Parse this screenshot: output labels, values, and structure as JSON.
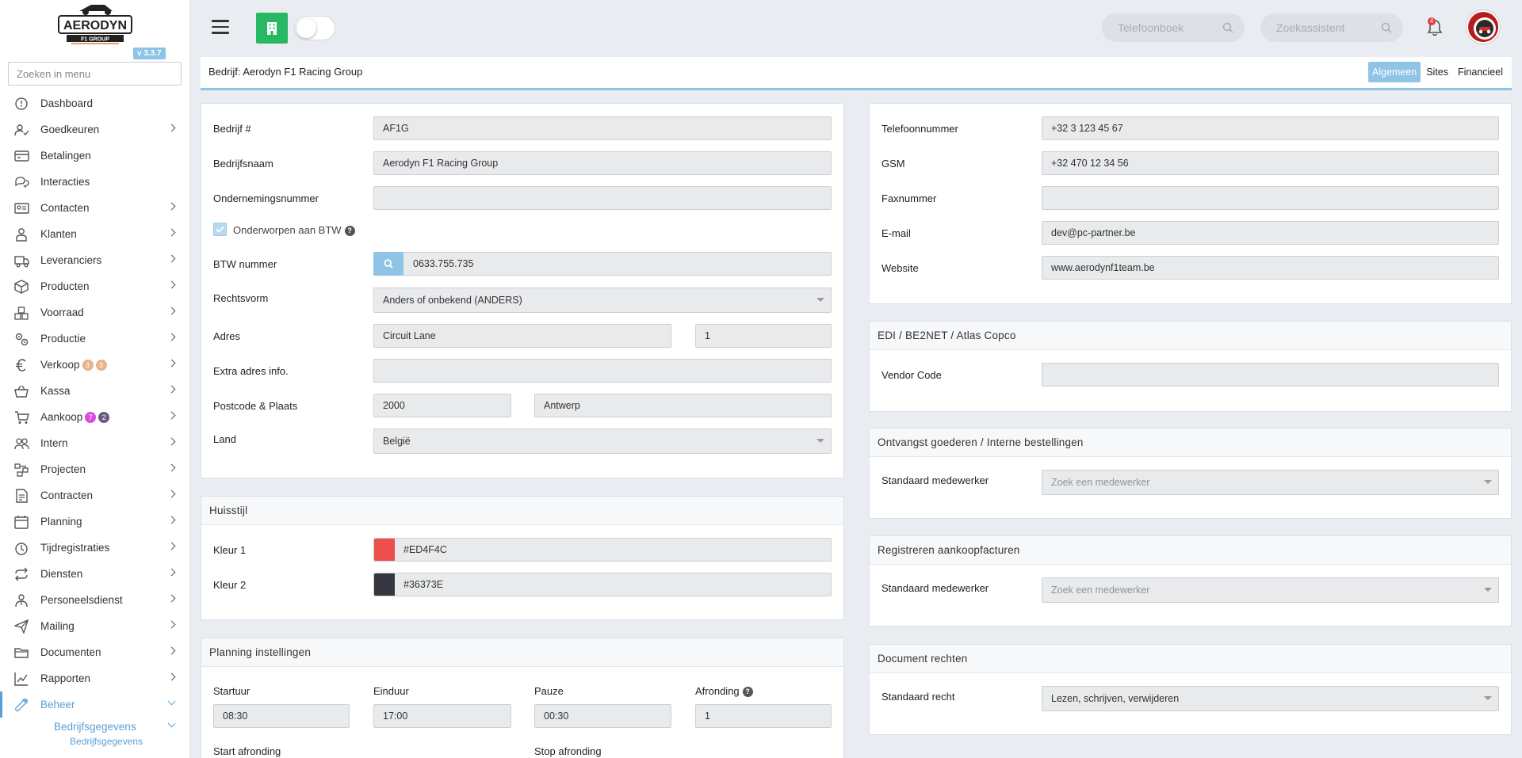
{
  "app": {
    "logo_text": "AERODYN",
    "logo_sub": "F1 GROUP",
    "version": "v 3.3.7"
  },
  "sidebar": {
    "search_placeholder": "Zoeken in menu",
    "items": [
      {
        "label": "Dashboard",
        "icon": "dashboard-icon",
        "chevron": false
      },
      {
        "label": "Goedkeuren",
        "icon": "user-check-icon",
        "chevron": true
      },
      {
        "label": "Betalingen",
        "icon": "credit-card-icon",
        "chevron": false
      },
      {
        "label": "Interacties",
        "icon": "chat-icon",
        "chevron": false
      },
      {
        "label": "Contacten",
        "icon": "contact-card-icon",
        "chevron": true
      },
      {
        "label": "Klanten",
        "icon": "customer-icon",
        "chevron": true
      },
      {
        "label": "Leveranciers",
        "icon": "truck-icon",
        "chevron": true
      },
      {
        "label": "Producten",
        "icon": "box-icon",
        "chevron": true
      },
      {
        "label": "Voorraad",
        "icon": "boxes-icon",
        "chevron": true
      },
      {
        "label": "Productie",
        "icon": "gears-icon",
        "chevron": true
      },
      {
        "label": "Verkoop",
        "icon": "euro-icon",
        "chevron": true,
        "badges": [
          {
            "text": "3",
            "color": "#e6b38a"
          },
          {
            "text": "3",
            "color": "#e6b38a"
          }
        ]
      },
      {
        "label": "Kassa",
        "icon": "basket-icon",
        "chevron": true
      },
      {
        "label": "Aankoop",
        "icon": "cart-icon",
        "chevron": true,
        "badges": [
          {
            "text": "7",
            "color": "#d94bd9"
          },
          {
            "text": "2",
            "color": "#6b5b7b"
          }
        ]
      },
      {
        "label": "Intern",
        "icon": "users-icon",
        "chevron": true
      },
      {
        "label": "Projecten",
        "icon": "project-icon",
        "chevron": true
      },
      {
        "label": "Contracten",
        "icon": "contract-icon",
        "chevron": true
      },
      {
        "label": "Planning",
        "icon": "calendar-icon",
        "chevron": true
      },
      {
        "label": "Tijdregistraties",
        "icon": "timer-icon",
        "chevron": true
      },
      {
        "label": "Diensten",
        "icon": "repeat-icon",
        "chevron": true
      },
      {
        "label": "Personeelsdienst",
        "icon": "personnel-icon",
        "chevron": true
      },
      {
        "label": "Mailing",
        "icon": "send-icon",
        "chevron": true
      },
      {
        "label": "Documenten",
        "icon": "folder-icon",
        "chevron": true
      },
      {
        "label": "Rapporten",
        "icon": "chart-line-icon",
        "chevron": true
      },
      {
        "label": "Beheer",
        "icon": "wrench-icon",
        "chevron": true,
        "active": true
      }
    ],
    "sub_item": "Bedrijfsgegevens",
    "sub_sub_item": "Bedrijfsgegevens"
  },
  "topbar": {
    "phonebook_placeholder": "Telefoonboek",
    "assistant_placeholder": "Zoekassistent",
    "notification_count": "4"
  },
  "page": {
    "title": "Bedrijf: Aerodyn F1 Racing Group",
    "tabs": [
      {
        "label": "Algemeen",
        "active": true
      },
      {
        "label": "Sites",
        "active": false
      },
      {
        "label": "Financieel",
        "active": false
      }
    ]
  },
  "general": {
    "company_no_label": "Bedrijf #",
    "company_no": "AF1G",
    "name_label": "Bedrijfsnaam",
    "name": "Aerodyn F1 Racing Group",
    "enterprise_no_label": "Ondernemingsnummer",
    "enterprise_no": "",
    "vat_subject_label": "Onderworpen aan BTW",
    "vat_label": "BTW nummer",
    "vat": "0633.755.735",
    "legal_form_label": "Rechtsvorm",
    "legal_form": "Anders of onbekend (ANDERS)",
    "address_label": "Adres",
    "street": "Circuit Lane",
    "house_no": "1",
    "extra_label": "Extra adres info.",
    "extra": "",
    "postal_label": "Postcode & Plaats",
    "postal": "2000",
    "city": "Antwerp",
    "country_label": "Land",
    "country": "België"
  },
  "contact": {
    "phone_label": "Telefoonnummer",
    "phone": "+32 3 123 45 67",
    "gsm_label": "GSM",
    "gsm": "+32 470 12 34 56",
    "fax_label": "Faxnummer",
    "fax": "",
    "email_label": "E-mail",
    "email": "dev@pc-partner.be",
    "website_label": "Website",
    "website": "www.aerodynf1team.be"
  },
  "style": {
    "title": "Huisstijl",
    "color1_label": "Kleur 1",
    "color1": "#ED4F4C",
    "color2_label": "Kleur 2",
    "color2": "#36373E"
  },
  "edi": {
    "title": "EDI / BE2NET / Atlas Copco",
    "vendor_label": "Vendor Code",
    "vendor": ""
  },
  "receipt": {
    "title": "Ontvangst goederen / Interne bestellingen",
    "employee_label": "Standaard medewerker",
    "employee_placeholder": "Zoek een medewerker"
  },
  "purchase": {
    "title": "Registreren aankoopfacturen",
    "employee_label": "Standaard medewerker",
    "employee_placeholder": "Zoek een medewerker"
  },
  "docs": {
    "title": "Document rechten",
    "right_label": "Standaard recht",
    "right": "Lezen, schrijven, verwijderen"
  },
  "planning": {
    "title": "Planning instellingen",
    "start_label": "Startuur",
    "start": "08:30",
    "end_label": "Einduur",
    "end": "17:00",
    "pause_label": "Pauze",
    "pause": "00:30",
    "rounding_label": "Afronding",
    "rounding": "1",
    "start_rounding_label": "Start afronding",
    "stop_rounding_label": "Stop afronding"
  },
  "colors": {
    "primary_blue": "#8FC4E6",
    "green": "#26B862"
  }
}
